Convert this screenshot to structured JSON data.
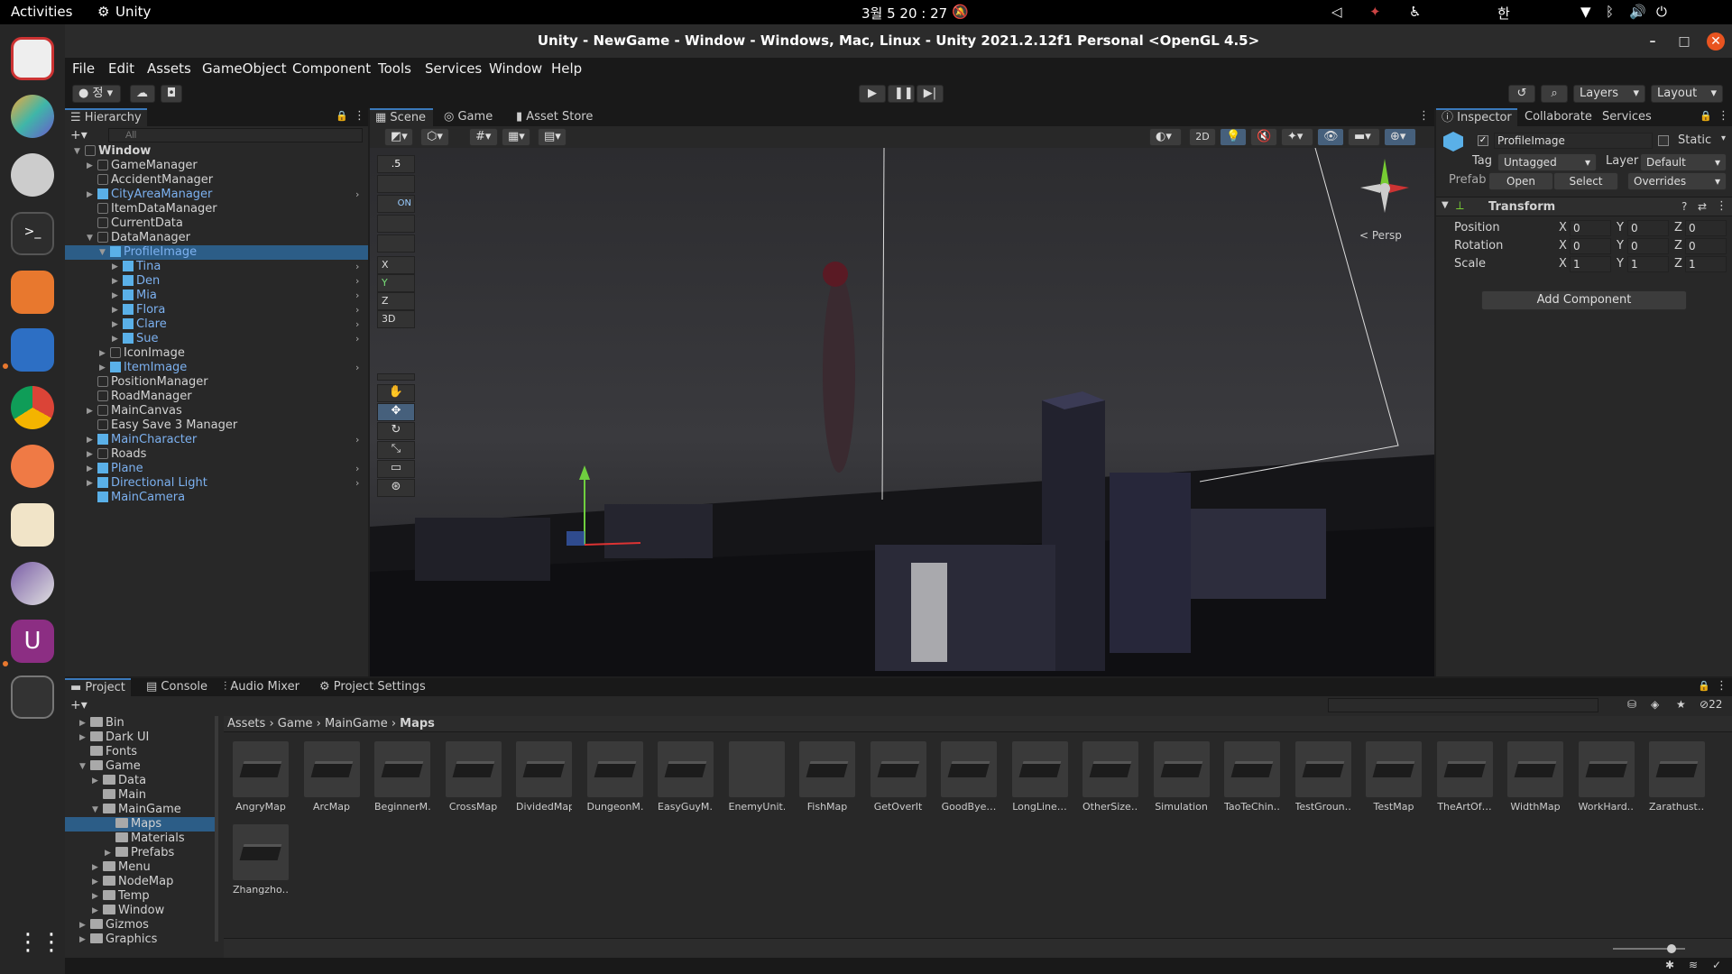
{
  "topbar": {
    "activities": "Activities",
    "app": "Unity",
    "clock": "3월 5 20 : 27",
    "ime": "한"
  },
  "window": {
    "title": "Unity - NewGame - Window - Windows, Mac, Linux - Unity 2021.2.12f1 Personal <OpenGL 4.5>"
  },
  "menu": [
    "File",
    "Edit",
    "Assets",
    "GameObject",
    "Component",
    "Tools",
    "Services",
    "Window",
    "Help"
  ],
  "toolbar": {
    "account_label": "정",
    "layers_label": "Layers",
    "layout_label": "Layout"
  },
  "hierarchy": {
    "tab": "Hierarchy",
    "search_placeholder": "All",
    "items": [
      {
        "label": "Window",
        "depth": 0,
        "bold": true,
        "blue": false,
        "expanded": true
      },
      {
        "label": "GameManager",
        "depth": 1,
        "blue": false,
        "arrow": true
      },
      {
        "label": "AccidentManager",
        "depth": 1,
        "blue": false
      },
      {
        "label": "CityAreaManager",
        "depth": 1,
        "blue": true,
        "arrow": true
      },
      {
        "label": "ItemDataManager",
        "depth": 1,
        "blue": false
      },
      {
        "label": "CurrentData",
        "depth": 1,
        "blue": false
      },
      {
        "label": "DataManager",
        "depth": 1,
        "blue": false,
        "expanded": true
      },
      {
        "label": "ProfileImage",
        "depth": 2,
        "blue": true,
        "expanded": true,
        "selected": true
      },
      {
        "label": "Tina",
        "depth": 3,
        "blue": true,
        "arrow": true
      },
      {
        "label": "Den",
        "depth": 3,
        "blue": true,
        "arrow": true
      },
      {
        "label": "Mia",
        "depth": 3,
        "blue": true,
        "arrow": true
      },
      {
        "label": "Flora",
        "depth": 3,
        "blue": true,
        "arrow": true
      },
      {
        "label": "Clare",
        "depth": 3,
        "blue": true,
        "arrow": true
      },
      {
        "label": "Sue",
        "depth": 3,
        "blue": true,
        "arrow": true
      },
      {
        "label": "IconImage",
        "depth": 2,
        "blue": false,
        "arrow": true
      },
      {
        "label": "ItemImage",
        "depth": 2,
        "blue": true,
        "arrow": true
      },
      {
        "label": "PositionManager",
        "depth": 1,
        "blue": false
      },
      {
        "label": "RoadManager",
        "depth": 1,
        "blue": false
      },
      {
        "label": "MainCanvas",
        "depth": 1,
        "blue": false,
        "arrow": true
      },
      {
        "label": "Easy Save 3 Manager",
        "depth": 1,
        "blue": false
      },
      {
        "label": "MainCharacter",
        "depth": 1,
        "blue": true,
        "arrow": true
      },
      {
        "label": "Roads",
        "depth": 1,
        "blue": false,
        "arrow": true
      },
      {
        "label": "Plane",
        "depth": 1,
        "blue": true,
        "arrow": true
      },
      {
        "label": "Directional Light",
        "depth": 1,
        "blue": true,
        "arrow": true
      },
      {
        "label": "MainCamera",
        "depth": 1,
        "blue": true
      }
    ]
  },
  "scene": {
    "tabs": [
      "Scene",
      "Game",
      "Asset Store"
    ],
    "snap_value": ".5",
    "on_label": "ON",
    "axis_labels": [
      "X",
      "Y",
      "Z"
    ],
    "mode3d": "3D",
    "btn_2d": "2D",
    "persp_label": "Persp"
  },
  "inspector": {
    "tabs": [
      "Inspector",
      "Collaborate",
      "Services"
    ],
    "object_name": "ProfileImage",
    "static_label": "Static",
    "tag_label": "Tag",
    "tag_value": "Untagged",
    "layer_label": "Layer",
    "layer_value": "Default",
    "prefab_label": "Prefab",
    "open_label": "Open",
    "select_label": "Select",
    "overrides_label": "Overrides",
    "transform_title": "Transform",
    "rows": [
      {
        "label": "Position",
        "x": "0",
        "y": "0",
        "z": "0"
      },
      {
        "label": "Rotation",
        "x": "0",
        "y": "0",
        "z": "0"
      },
      {
        "label": "Scale",
        "x": "1",
        "y": "1",
        "z": "1"
      }
    ],
    "add_component": "Add Component"
  },
  "bottom": {
    "tabs": [
      "Project",
      "Console",
      "Audio Mixer",
      "Project Settings"
    ],
    "hidden_count": "22",
    "breadcrumb": [
      "Assets",
      "Game",
      "MainGame",
      "Maps"
    ],
    "tree": [
      {
        "label": "Bin",
        "depth": 1,
        "arrow": true
      },
      {
        "label": "Dark UI",
        "depth": 1,
        "arrow": true
      },
      {
        "label": "Fonts",
        "depth": 1
      },
      {
        "label": "Game",
        "depth": 1,
        "expanded": true
      },
      {
        "label": "Data",
        "depth": 2,
        "arrow": true
      },
      {
        "label": "Main",
        "depth": 2
      },
      {
        "label": "MainGame",
        "depth": 2,
        "expanded": true
      },
      {
        "label": "Maps",
        "depth": 3,
        "selected": true
      },
      {
        "label": "Materials",
        "depth": 3
      },
      {
        "label": "Prefabs",
        "depth": 3,
        "arrow": true
      },
      {
        "label": "Menu",
        "depth": 2,
        "arrow": true
      },
      {
        "label": "NodeMap",
        "depth": 2,
        "arrow": true
      },
      {
        "label": "Temp",
        "depth": 2,
        "arrow": true
      },
      {
        "label": "Window",
        "depth": 2,
        "arrow": true
      },
      {
        "label": "Gizmos",
        "depth": 1,
        "arrow": true
      },
      {
        "label": "Graphics",
        "depth": 1,
        "arrow": true
      }
    ],
    "assets": [
      "AngryMap",
      "ArcMap",
      "BeginnerM…",
      "CrossMap",
      "DividedMap",
      "DungeonM…",
      "EasyGuyM…",
      "EnemyUnit…",
      "FishMap",
      "GetOverIt",
      "GoodBye…",
      "LongLine…",
      "OtherSize…",
      "Simulation",
      "TaoTeChin…",
      "TestGroun…",
      "TestMap",
      "TheArtOf…",
      "WidthMap",
      "WorkHard…",
      "Zarathust…",
      "Zhangzho…"
    ]
  }
}
